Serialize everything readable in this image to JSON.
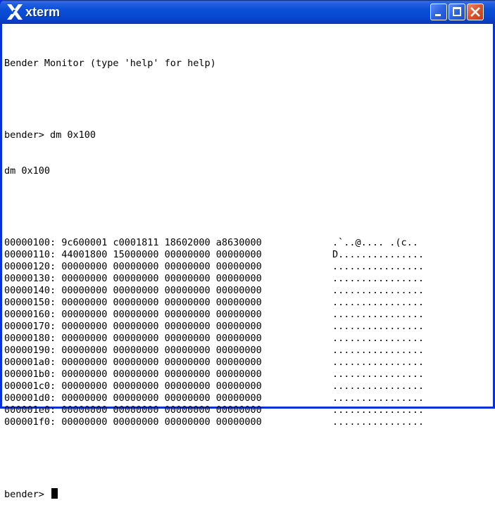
{
  "window": {
    "title": "xterm",
    "icon": "x-logo-icon",
    "controls": [
      "minimize-icon",
      "maximize-icon",
      "close-icon"
    ]
  },
  "terminal": {
    "banner": "Bender Monitor (type 'help' for help)",
    "command_prompt_line": "bender> dm 0x100",
    "echo_line": "dm 0x100",
    "dump_rows": [
      {
        "addr": "00000100:",
        "words": "9c600001 c0001811 18602000 a8630000",
        "ascii": ".`..@.... .(c.."
      },
      {
        "addr": "00000110:",
        "words": "44001800 15000000 00000000 00000000",
        "ascii": "D..............."
      },
      {
        "addr": "00000120:",
        "words": "00000000 00000000 00000000 00000000",
        "ascii": "................"
      },
      {
        "addr": "00000130:",
        "words": "00000000 00000000 00000000 00000000",
        "ascii": "................"
      },
      {
        "addr": "00000140:",
        "words": "00000000 00000000 00000000 00000000",
        "ascii": "................"
      },
      {
        "addr": "00000150:",
        "words": "00000000 00000000 00000000 00000000",
        "ascii": "................"
      },
      {
        "addr": "00000160:",
        "words": "00000000 00000000 00000000 00000000",
        "ascii": "................"
      },
      {
        "addr": "00000170:",
        "words": "00000000 00000000 00000000 00000000",
        "ascii": "................"
      },
      {
        "addr": "00000180:",
        "words": "00000000 00000000 00000000 00000000",
        "ascii": "................"
      },
      {
        "addr": "00000190:",
        "words": "00000000 00000000 00000000 00000000",
        "ascii": "................"
      },
      {
        "addr": "000001a0:",
        "words": "00000000 00000000 00000000 00000000",
        "ascii": "................"
      },
      {
        "addr": "000001b0:",
        "words": "00000000 00000000 00000000 00000000",
        "ascii": "................"
      },
      {
        "addr": "000001c0:",
        "words": "00000000 00000000 00000000 00000000",
        "ascii": "................"
      },
      {
        "addr": "000001d0:",
        "words": "00000000 00000000 00000000 00000000",
        "ascii": "................"
      },
      {
        "addr": "000001e0:",
        "words": "00000000 00000000 00000000 00000000",
        "ascii": "................"
      },
      {
        "addr": "000001f0:",
        "words": "00000000 00000000 00000000 00000000",
        "ascii": "................"
      }
    ],
    "final_prompt": "bender>"
  },
  "colors": {
    "frame": "#0831d9",
    "titlebar": "#0a4fd6",
    "close_button": "#d9532b",
    "terminal_bg": "#ffffff",
    "terminal_fg": "#000000"
  }
}
